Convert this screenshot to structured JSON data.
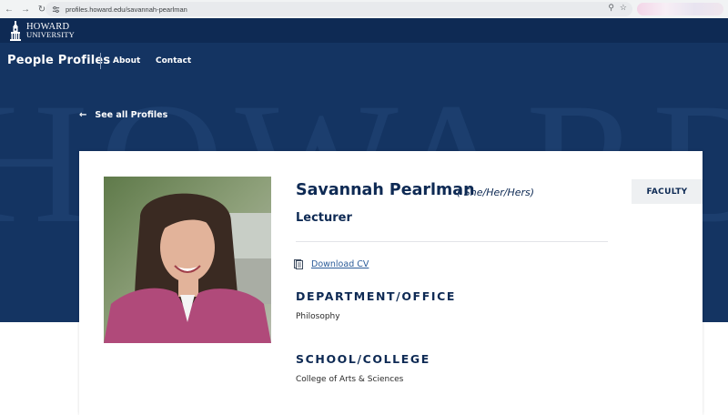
{
  "browser": {
    "url": "profiles.howard.edu/savannah-pearlman",
    "icons": [
      "back-icon",
      "forward-icon",
      "reload-icon",
      "site-settings-icon",
      "zoom-icon",
      "bookmark-star-icon"
    ]
  },
  "brand": {
    "line1": "HOWARD",
    "line2": "UNIVERSITY"
  },
  "header": {
    "site_title": "People Profiles",
    "nav": [
      {
        "label": "About"
      },
      {
        "label": "Contact"
      }
    ],
    "watermark": "HOWARD"
  },
  "back_link": {
    "label": "See all Profiles"
  },
  "profile": {
    "name": "Savannah Pearlman",
    "pronouns": "( She/Her/Hers)",
    "title": "Lecturer",
    "cv_label": "Download CV",
    "badge": "FACULTY",
    "sections": [
      {
        "heading": "DEPARTMENT/OFFICE",
        "value": "Philosophy"
      },
      {
        "heading": "SCHOOL/COLLEGE",
        "value": "College of Arts & Sciences"
      }
    ]
  },
  "colors": {
    "navy": "#0e2a54",
    "hero": "#143462",
    "link": "#2b5c99"
  }
}
